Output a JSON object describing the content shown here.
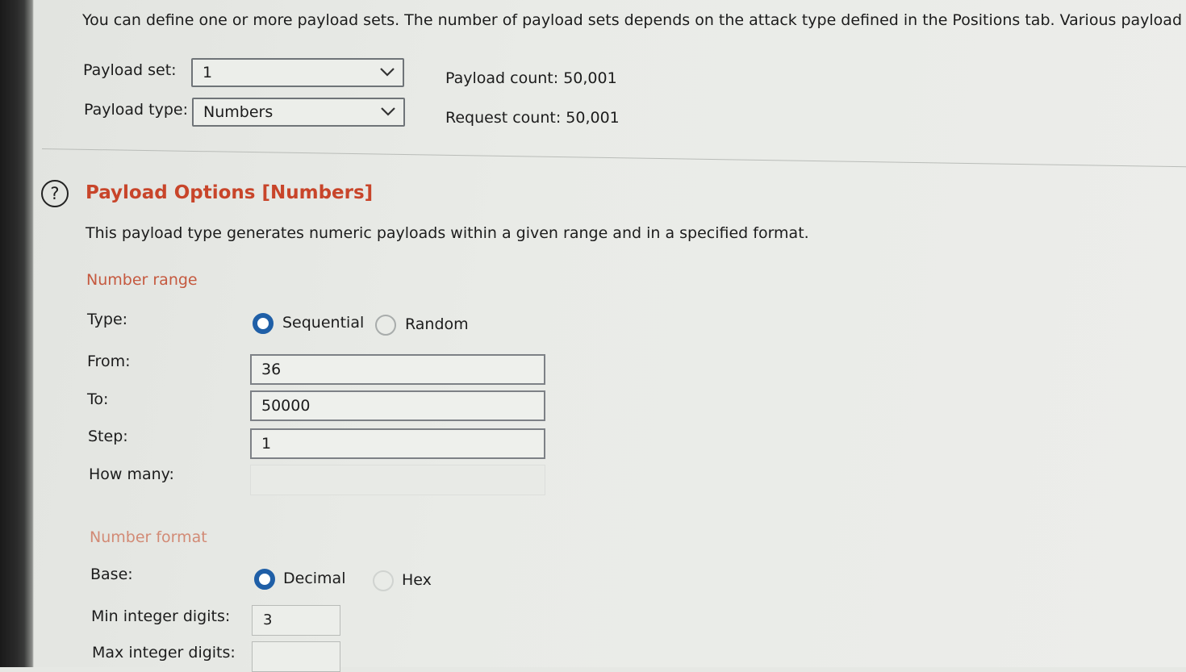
{
  "intro_text": "You can define one or more payload sets. The number of payload sets depends on the attack type defined in the Positions tab. Various payload types",
  "payload_set": {
    "label": "Payload set:",
    "value": "1"
  },
  "payload_type": {
    "label": "Payload type:",
    "value": "Numbers"
  },
  "payload_count": {
    "label": "Payload count:",
    "value": "50,001"
  },
  "request_count": {
    "label": "Request count:",
    "value": "50,001"
  },
  "options": {
    "help_glyph": "?",
    "title": "Payload Options [Numbers]",
    "description": "This payload type generates numeric payloads within a given range and in a specified format."
  },
  "number_range": {
    "heading": "Number range",
    "type_label": "Type:",
    "type_options": [
      {
        "label": "Sequential",
        "selected": true
      },
      {
        "label": "Random",
        "selected": false
      }
    ],
    "from_label": "From:",
    "from_value": "36",
    "to_label": "To:",
    "to_value": "50000",
    "step_label": "Step:",
    "step_value": "1",
    "how_many_label": "How many:",
    "how_many_value": ""
  },
  "number_format": {
    "heading": "Number format",
    "base_label": "Base:",
    "base_options": [
      {
        "label": "Decimal",
        "selected": true
      },
      {
        "label": "Hex",
        "selected": false
      }
    ],
    "min_int_label": "Min integer digits:",
    "min_int_value": "3",
    "max_int_label": "Max integer digits:",
    "max_int_value": ""
  },
  "icons": {
    "dropdown": "chevron-down-icon",
    "help": "help-icon"
  },
  "colors": {
    "accent_heading": "#c8452a",
    "radio_selected": "#1f5fa7"
  }
}
